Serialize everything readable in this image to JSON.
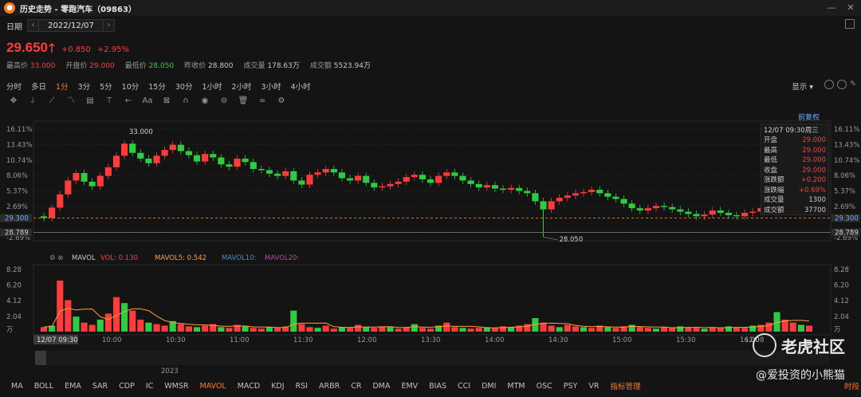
{
  "titlebar": {
    "title": "历史走势 - 零跑汽车（09863）",
    "logo_char": "●"
  },
  "date": {
    "label": "日期",
    "value": "2022/12/07",
    "prev": "‹",
    "next": "›"
  },
  "quote": {
    "price": "29.650",
    "change": "+0.850",
    "change_pct": "+2.95%",
    "color_up": "#ff3b3b",
    "color_down": "#2ecc40"
  },
  "stats": [
    {
      "label": "最高价",
      "value": "33.000",
      "tone": "red"
    },
    {
      "label": "开盘价",
      "value": "29.000",
      "tone": "red"
    },
    {
      "label": "最低价",
      "value": "28.050",
      "tone": "green"
    },
    {
      "label": "昨收价",
      "value": "28.800",
      "tone": "white"
    },
    {
      "label": "成交量",
      "value": "178.63万",
      "tone": "white"
    },
    {
      "label": "成交额",
      "value": "5523.94万",
      "tone": "white"
    }
  ],
  "periods": [
    "分时",
    "多日",
    "1分",
    "3分",
    "5分",
    "10分",
    "15分",
    "30分",
    "1小时",
    "2小时",
    "3小时",
    "4小时"
  ],
  "active_period": "1分",
  "display_label": "显示",
  "fuquan_label": "前复权",
  "indicators": [
    "MA",
    "BOLL",
    "EMA",
    "SAR",
    "CDP",
    "IC",
    "WMSR",
    "MAVOL",
    "MACD",
    "KDJ",
    "RSI",
    "ARBR",
    "CR",
    "DMA",
    "EMV",
    "BIAS",
    "CCI",
    "DMI",
    "MTM",
    "OSC",
    "PSY",
    "VR"
  ],
  "active_indicator": "MAVOL",
  "indicator_manage_label": "指标管理",
  "time_label": "时段",
  "infobox": {
    "head": "12/07 09:30周三",
    "rows": [
      {
        "k": "开盘",
        "v": "29.000",
        "tone": "red"
      },
      {
        "k": "最高",
        "v": "29.000",
        "tone": "red"
      },
      {
        "k": "最低",
        "v": "29.000",
        "tone": "red"
      },
      {
        "k": "收盘",
        "v": "29.000",
        "tone": "red"
      },
      {
        "k": "涨跌额",
        "v": "+0.200",
        "tone": "red"
      },
      {
        "k": "涨跌幅",
        "v": "+0.69%",
        "tone": "red"
      },
      {
        "k": "成交量",
        "v": "1300",
        "tone": "white"
      },
      {
        "k": "成交额",
        "v": "37700",
        "tone": "white"
      }
    ]
  },
  "chart_data": {
    "type": "candlestick",
    "price_axis_pct": [
      "16.11%",
      "13.43%",
      "10.74%",
      "8.06%",
      "5.37%",
      "2.69%",
      "-2.69%"
    ],
    "price_axis_pct_values": [
      16.11,
      13.43,
      10.74,
      8.06,
      5.37,
      2.69,
      -2.69
    ],
    "left_price_axis_pct": [
      "16.11%",
      "13.43%",
      "10.74%",
      "8.06%",
      "5.37%",
      "2.69%",
      "-2.69%"
    ],
    "prev_close": 28.8,
    "prev_close_label": "28.789",
    "current_marker": "29.300",
    "high_label": "33.000",
    "low_label": "28.050",
    "time_ticks": [
      "10:00",
      "10:30",
      "11:00",
      "11:30",
      "12:00",
      "13:30",
      "14:00",
      "14:30",
      "15:00",
      "15:30",
      "16:00"
    ],
    "cursor_time": "12/07 09:30",
    "cursor_time_right": "12/08",
    "year_label": "2023",
    "close_series_pct": [
      0.7,
      2.5,
      4.8,
      7.2,
      8.5,
      7.0,
      6.2,
      8.0,
      9.5,
      11.5,
      13.6,
      12.0,
      11.0,
      10.2,
      11.5,
      12.5,
      13.4,
      12.3,
      11.6,
      10.5,
      11.8,
      11.2,
      10.0,
      9.6,
      11.0,
      10.4,
      9.2,
      9.0,
      8.4,
      8.0,
      8.8,
      7.2,
      6.5,
      8.2,
      8.6,
      9.2,
      8.6,
      7.6,
      7.2,
      8.0,
      6.8,
      6.0,
      6.2,
      6.6,
      7.0,
      7.8,
      8.2,
      7.4,
      6.8,
      8.0,
      8.6,
      8.0,
      7.2,
      6.6,
      6.0,
      6.4,
      5.8,
      5.6,
      5.9,
      5.4,
      5.0,
      3.6,
      2.2,
      3.6,
      4.2,
      4.6,
      5.0,
      5.2,
      5.6,
      5.0,
      4.4,
      4.0,
      3.2,
      2.4,
      2.0,
      2.4,
      2.8,
      2.6,
      2.2,
      1.8,
      1.4,
      1.0,
      1.3,
      2.0,
      1.6,
      1.2,
      1.0,
      1.6,
      1.8,
      2.4,
      3.2,
      6.5,
      8.0,
      5.8,
      6.6,
      5.4
    ],
    "volume_axis": [
      "8.28",
      "6.20",
      "4.12",
      "2.04",
      "万"
    ],
    "volume_axis_values": [
      8.28,
      6.2,
      4.12,
      2.04
    ],
    "volume_series": [
      0.6,
      0.8,
      6.8,
      4.2,
      2.0,
      1.2,
      0.9,
      1.6,
      2.4,
      4.6,
      3.8,
      2.8,
      1.6,
      1.2,
      1.0,
      0.8,
      1.4,
      1.0,
      0.7,
      0.6,
      0.8,
      1.0,
      0.6,
      0.5,
      0.9,
      0.7,
      0.5,
      0.4,
      0.6,
      0.5,
      0.7,
      2.8,
      1.0,
      0.6,
      0.5,
      0.8,
      0.4,
      0.6,
      0.5,
      0.9,
      0.6,
      0.5,
      0.7,
      0.6,
      0.4,
      0.6,
      1.0,
      0.5,
      0.4,
      0.8,
      1.2,
      0.6,
      0.5,
      0.4,
      0.5,
      0.6,
      0.5,
      0.7,
      0.6,
      0.8,
      1.0,
      1.8,
      1.2,
      0.8,
      0.6,
      0.9,
      0.7,
      0.6,
      0.5,
      0.8,
      0.6,
      0.5,
      0.7,
      0.9,
      0.6,
      0.5,
      0.4,
      0.6,
      0.5,
      0.7,
      0.6,
      0.5,
      0.4,
      0.6,
      0.5,
      0.7,
      0.6,
      0.5,
      0.8,
      0.9,
      1.2,
      2.6,
      1.6,
      1.2,
      0.9,
      0.8
    ],
    "mavol": {
      "label": "MAVOL",
      "vol": "VOL: 0.130",
      "mavol5": "MAVOL5: 0.542",
      "mavol10": "MAVOL10:",
      "mavol20": "MAVOL20:"
    }
  },
  "watermark": {
    "line1": "老虎社区",
    "line2": "@爱投资的小熊猫"
  }
}
